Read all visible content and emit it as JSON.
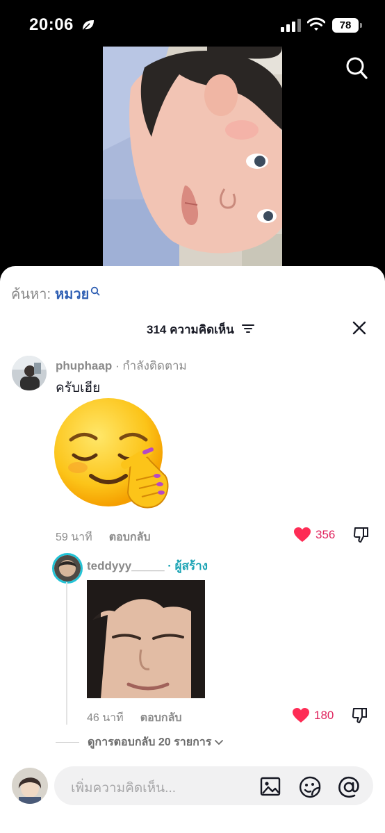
{
  "status": {
    "time": "20:06",
    "battery": "78"
  },
  "search": {
    "label": "ค้นหา:",
    "term": "หมวย"
  },
  "comments_header": {
    "count_label": "314 ความคิดเห็น"
  },
  "comment": {
    "username": "phuphaap",
    "tag": " · กำลังติดตาม",
    "text": "ครับเฮีย",
    "time": "59 นาที",
    "reply_label": "ตอบกลับ",
    "likes": "356"
  },
  "reply": {
    "username": "teddyyy_____",
    "tag": " · ผู้สร้าง",
    "time": "46 นาที",
    "reply_label": "ตอบกลับ",
    "likes": "180"
  },
  "view_replies": "ดูการตอบกลับ 20 รายการ",
  "input": {
    "placeholder": "เพิ่มความคิดเห็น..."
  },
  "colors": {
    "like": "#e0245e",
    "creator": "#1aa3b4",
    "search_term": "#2f5fb3"
  },
  "icons": [
    "leaf-icon",
    "search-icon",
    "filter-icon",
    "close-icon",
    "heart-icon",
    "dislike-icon",
    "chevron-down-icon",
    "image-icon",
    "sticker-icon",
    "mention-icon"
  ]
}
